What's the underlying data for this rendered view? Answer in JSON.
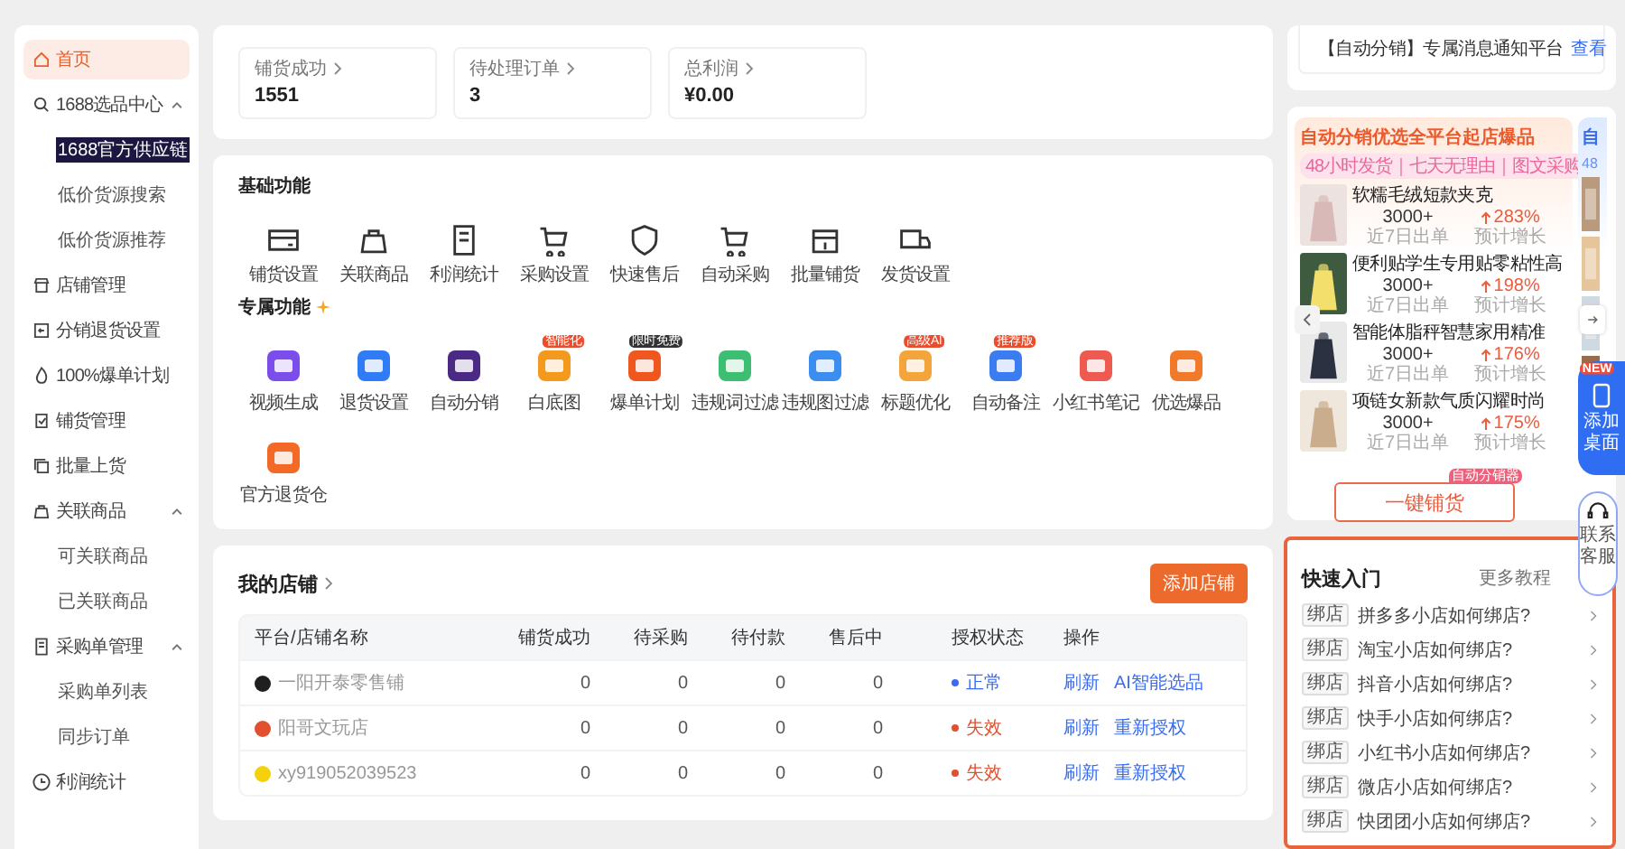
{
  "sidebar": {
    "items": [
      {
        "label": "首页",
        "selected": true
      },
      {
        "label": "1688选品中心",
        "selected": false,
        "expanded": true,
        "children": [
          {
            "label": "1688官方供应链",
            "selected": true
          },
          {
            "label": "低价货源搜索",
            "selected": false
          },
          {
            "label": "低价货源推荐",
            "selected": false
          }
        ]
      },
      {
        "label": "店铺管理",
        "selected": false
      },
      {
        "label": "分销退货设置",
        "selected": false
      },
      {
        "label": "100%爆单计划",
        "selected": false
      },
      {
        "label": "铺货管理",
        "selected": false
      },
      {
        "label": "批量上货",
        "selected": false
      },
      {
        "label": "关联商品",
        "selected": false,
        "expanded": true,
        "children": [
          {
            "label": "可关联商品",
            "selected": false
          },
          {
            "label": "已关联商品",
            "selected": false
          }
        ]
      },
      {
        "label": "采购单管理",
        "selected": false,
        "expanded": true,
        "children": [
          {
            "label": "采购单列表",
            "selected": false
          },
          {
            "label": "同步订单",
            "selected": false
          }
        ]
      },
      {
        "label": "利润统计",
        "selected": false
      }
    ]
  },
  "stats": [
    {
      "label": "铺货成功",
      "value": "1551"
    },
    {
      "label": "待处理订单",
      "value": "3"
    },
    {
      "label": "总利润",
      "value": "¥0.00"
    }
  ],
  "basic_features": {
    "title": "基础功能",
    "items": [
      "铺货设置",
      "关联商品",
      "利润统计",
      "采购设置",
      "快速售后",
      "自动采购",
      "批量铺货",
      "发货设置"
    ]
  },
  "exclusive_features": {
    "title": "专属功能",
    "items": [
      {
        "label": "视频生成"
      },
      {
        "label": "退货设置"
      },
      {
        "label": "自动分销"
      },
      {
        "label": "白底图",
        "badge": "智能化",
        "badge_dark": false
      },
      {
        "label": "爆单计划",
        "badge": "限时免费",
        "badge_dark": true
      },
      {
        "label": "违规词过滤"
      },
      {
        "label": "违规图过滤"
      },
      {
        "label": "标题优化",
        "badge": "高级AI",
        "badge_dark": false
      },
      {
        "label": "自动备注",
        "badge": "推荐版",
        "badge_dark": false
      },
      {
        "label": "小红书笔记"
      },
      {
        "label": "优选爆品"
      },
      {
        "label": "官方退货仓"
      }
    ]
  },
  "stores": {
    "title": "我的店铺",
    "add_button": "添加店铺",
    "columns": [
      "平台/店铺名称",
      "铺货成功",
      "待采购",
      "待付款",
      "售后中",
      "授权状态",
      "操作"
    ],
    "rows": [
      {
        "name": "一阳开泰零售铺",
        "color": "#1f1f1f",
        "values": [
          "0",
          "0",
          "0",
          "0"
        ],
        "status": {
          "text": "正常",
          "color": "#3b6cf0"
        },
        "actions": [
          "刷新",
          "AI智能选品"
        ]
      },
      {
        "name": "阳哥文玩店",
        "color": "#e2502f",
        "values": [
          "0",
          "0",
          "0",
          "0"
        ],
        "status": {
          "text": "失效",
          "color": "#e2502f"
        },
        "actions": [
          "刷新",
          "重新授权"
        ]
      },
      {
        "name": "xy919052039523",
        "color": "#f5d10c",
        "values": [
          "0",
          "0",
          "0",
          "0"
        ],
        "status": {
          "text": "失效",
          "color": "#e2502f"
        },
        "actions": [
          "刷新",
          "重新授权"
        ]
      }
    ]
  },
  "notice": {
    "text": "【自动分销】专属消息通知平台",
    "link": "查看"
  },
  "promo": {
    "title": "自动分销优选全平台起店爆品",
    "tags": "48小时发货｜七天无理由｜图文采购",
    "products": [
      {
        "name": "软糯毛绒短款夹克",
        "sales": "3000+",
        "sales_label": "近7日出单",
        "growth": "283%",
        "growth_label": "预计增长"
      },
      {
        "name": "便利贴学生专用贴零粘性高",
        "sales": "3000+",
        "sales_label": "近7日出单",
        "growth": "198%",
        "growth_label": "预计增长"
      },
      {
        "name": "智能体脂秤智慧家用精准",
        "sales": "3000+",
        "sales_label": "近7日出单",
        "growth": "176%",
        "growth_label": "预计增长"
      },
      {
        "name": "项链女新款气质闪耀时尚",
        "sales": "3000+",
        "sales_label": "近7日出单",
        "growth": "175%",
        "growth_label": "预计增长"
      }
    ],
    "button": "一键铺货",
    "button_badge": "自动分销器",
    "peek_title": "自",
    "peek_tag": "48"
  },
  "floating": {
    "new_badge": "NEW",
    "desktop": "添加桌面",
    "support": "联系客服"
  },
  "quick_start": {
    "title": "快速入门",
    "more": "更多教程",
    "items": [
      {
        "tag": "绑店",
        "text": "拼多多小店如何绑店?"
      },
      {
        "tag": "绑店",
        "text": "淘宝小店如何绑店?"
      },
      {
        "tag": "绑店",
        "text": "抖音小店如何绑店?"
      },
      {
        "tag": "绑店",
        "text": "快手小店如何绑店?"
      },
      {
        "tag": "绑店",
        "text": "小红书小店如何绑店?"
      },
      {
        "tag": "绑店",
        "text": "微店小店如何绑店?"
      },
      {
        "tag": "绑店",
        "text": "快团团小店如何绑店?"
      }
    ]
  }
}
